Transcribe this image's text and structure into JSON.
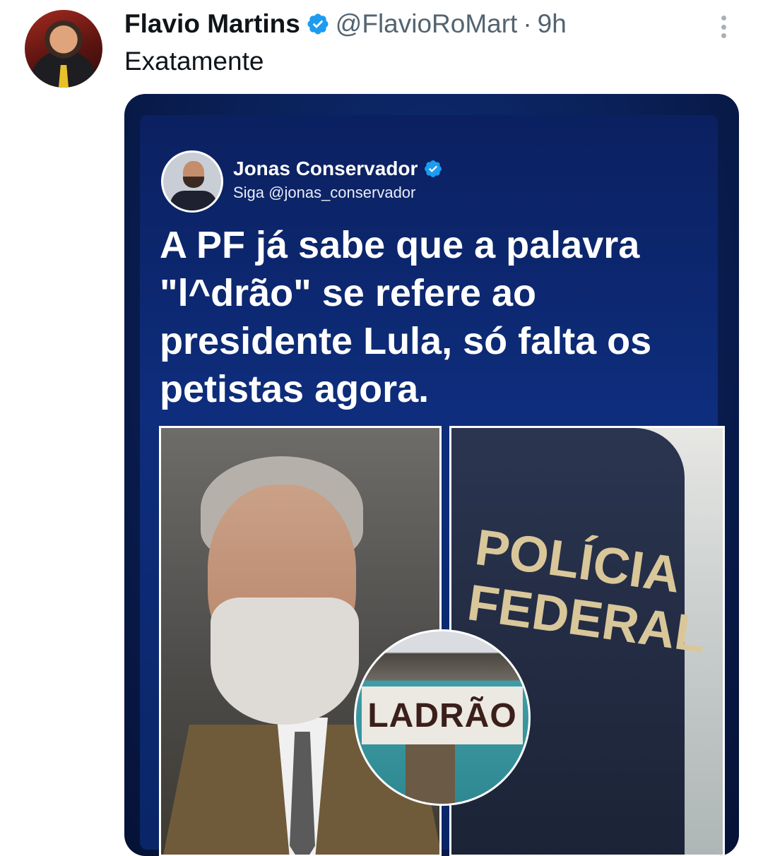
{
  "tweet": {
    "author_name": "Flavio Martins",
    "handle": "@FlavioRoMart",
    "separator": "·",
    "time": "9h",
    "text": "Exatamente"
  },
  "media": {
    "embedded_post": {
      "author_name": "Jonas Conservador",
      "subtitle": "Siga @jonas_conservador",
      "headline": "A PF já sabe que a palavra \"l^drão\" se refere ao presidente Lula, só falta os petistas agora."
    },
    "photo_right_text": "POLÍCIA FEDERAL",
    "inset_sign_text": "LADRÃO"
  },
  "colors": {
    "verified": "#1d9bf0",
    "muted_text": "#536471",
    "card_blue": "#0e2d7c"
  },
  "icons": {
    "verified": "verified-badge-icon",
    "more": "more-vertical-icon"
  }
}
